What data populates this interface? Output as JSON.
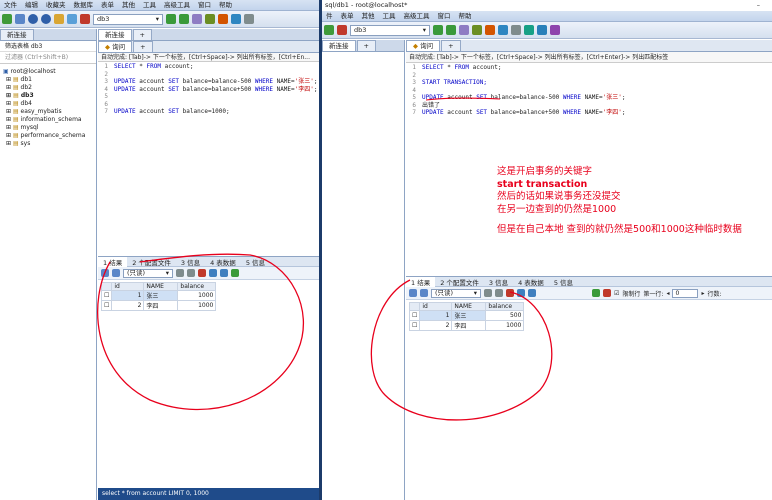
{
  "left": {
    "menu": [
      "文件",
      "编辑",
      "收藏夹",
      "数据库",
      "表单",
      "其他",
      "工具",
      "高级工具",
      "窗口",
      "帮助"
    ],
    "db_selected": "db3",
    "conn_tabs": [
      "新连接",
      "新连接"
    ],
    "filter_label": "筛选表格 db3",
    "filter_placeholder": "过滤器 (Ctrl+Shift+B)",
    "root_node": "root@localhost",
    "databases": [
      "db1",
      "db2",
      "db3",
      "db4",
      "easy_mybatis",
      "information_schema",
      "mysql",
      "performance_schema",
      "sys"
    ],
    "query_tab": "询问",
    "autocomplete_hint": "自动完成: [Tab]-> 下一个标签，[Ctrl+Space]-> 列出所有标签，[Ctrl+En...",
    "code_lines": [
      {
        "n": "1",
        "parts": [
          {
            "t": "SELECT",
            "c": "kw"
          },
          {
            "t": " * ",
            "c": ""
          },
          {
            "t": "FROM",
            "c": "kw"
          },
          {
            "t": " account;",
            "c": ""
          }
        ]
      },
      {
        "n": "2",
        "parts": []
      },
      {
        "n": "3",
        "parts": [
          {
            "t": "UPDATE",
            "c": "kw"
          },
          {
            "t": " account ",
            "c": ""
          },
          {
            "t": "SET",
            "c": "kw"
          },
          {
            "t": " balance=balance-500 ",
            "c": ""
          },
          {
            "t": "WHERE",
            "c": "kw"
          },
          {
            "t": " NAME=",
            "c": ""
          },
          {
            "t": "'张三'",
            "c": "str"
          },
          {
            "t": ";",
            "c": ""
          }
        ]
      },
      {
        "n": "4",
        "parts": [
          {
            "t": "UPDATE",
            "c": "kw"
          },
          {
            "t": " account ",
            "c": ""
          },
          {
            "t": "SET",
            "c": "kw"
          },
          {
            "t": " balance=balance+500 ",
            "c": ""
          },
          {
            "t": "WHERE",
            "c": "kw"
          },
          {
            "t": " NAME=",
            "c": ""
          },
          {
            "t": "'李四'",
            "c": "str"
          },
          {
            "t": ";",
            "c": ""
          }
        ]
      },
      {
        "n": "5",
        "parts": []
      },
      {
        "n": "6",
        "parts": []
      },
      {
        "n": "7",
        "parts": [
          {
            "t": "UPDATE",
            "c": "kw"
          },
          {
            "t": " account ",
            "c": ""
          },
          {
            "t": "SET",
            "c": "kw"
          },
          {
            "t": " balance=1000;",
            "c": ""
          }
        ]
      }
    ],
    "result_tabs": [
      "1 结果",
      "2 个配置文件",
      "3 信息",
      "4 表数据",
      "5 信息"
    ],
    "readonly": "(只读)",
    "columns": [
      "id",
      "NAME",
      "balance"
    ],
    "rows": [
      [
        "1",
        "张三",
        "1000"
      ],
      [
        "2",
        "李四",
        "1000"
      ]
    ],
    "status": "select * from account LIMIT 0, 1000"
  },
  "right": {
    "title": "sql/db1 - root@localhost*",
    "menu": [
      "件",
      "表单",
      "其他",
      "工具",
      "高级工具",
      "窗口",
      "帮助"
    ],
    "db_selected": "db3",
    "conn_tab": "新连接",
    "query_tab": "询问",
    "autocomplete_hint": "自动完成: [Tab]-> 下一个标签，[Ctrl+Space]-> 列出所有标签，[Ctrl+Enter]-> 列出匹配标签",
    "code_lines": [
      {
        "n": "1",
        "parts": [
          {
            "t": "SELECT",
            "c": "kw"
          },
          {
            "t": " * ",
            "c": ""
          },
          {
            "t": "FROM",
            "c": "kw"
          },
          {
            "t": " account;",
            "c": ""
          }
        ]
      },
      {
        "n": "2",
        "parts": []
      },
      {
        "n": "3",
        "parts": [
          {
            "t": "START TRANSACTION;",
            "c": "kw"
          }
        ]
      },
      {
        "n": "4",
        "parts": []
      },
      {
        "n": "5",
        "parts": [
          {
            "t": "UPDATE",
            "c": "kw"
          },
          {
            "t": " account ",
            "c": ""
          },
          {
            "t": "SET",
            "c": "kw"
          },
          {
            "t": " balance=balance-500 ",
            "c": ""
          },
          {
            "t": "WHERE",
            "c": "kw"
          },
          {
            "t": " NAME=",
            "c": ""
          },
          {
            "t": "'张三'",
            "c": "str"
          },
          {
            "t": ";",
            "c": ""
          }
        ]
      },
      {
        "n": "6",
        "parts": [
          {
            "t": "出错了",
            "c": ""
          }
        ]
      },
      {
        "n": "7",
        "parts": [
          {
            "t": "UPDATE",
            "c": "kw"
          },
          {
            "t": " account ",
            "c": ""
          },
          {
            "t": "SET",
            "c": "kw"
          },
          {
            "t": " balance=balance+500 ",
            "c": ""
          },
          {
            "t": "WHERE",
            "c": "kw"
          },
          {
            "t": " NAME=",
            "c": ""
          },
          {
            "t": "'李四'",
            "c": "str"
          },
          {
            "t": ";",
            "c": ""
          }
        ]
      }
    ],
    "annotations": [
      "这是开启事务的关键字",
      "start transaction",
      "然后的话如果说事务还没提交",
      "在另一边查到的仍然是1000",
      "",
      "但是在自己本地 查到的就仍然是500和1000这种临时数据"
    ],
    "result_tabs": [
      "1 结果",
      "2 个配置文件",
      "3 信息",
      "4 表数据",
      "5 信息"
    ],
    "readonly": "(只读)",
    "limit_label": "限制行",
    "first_row_label": "第一行:",
    "first_row_value": "0",
    "rows_label": "行数:",
    "columns": [
      "id",
      "NAME",
      "balance"
    ],
    "rows": [
      [
        "1",
        "张三",
        "500"
      ],
      [
        "2",
        "李四",
        "1000"
      ]
    ]
  },
  "colors": {
    "annotation": "#e8001c",
    "keyword": "#0000c8",
    "string": "#c00000",
    "desktop": "#1c3b6a"
  }
}
